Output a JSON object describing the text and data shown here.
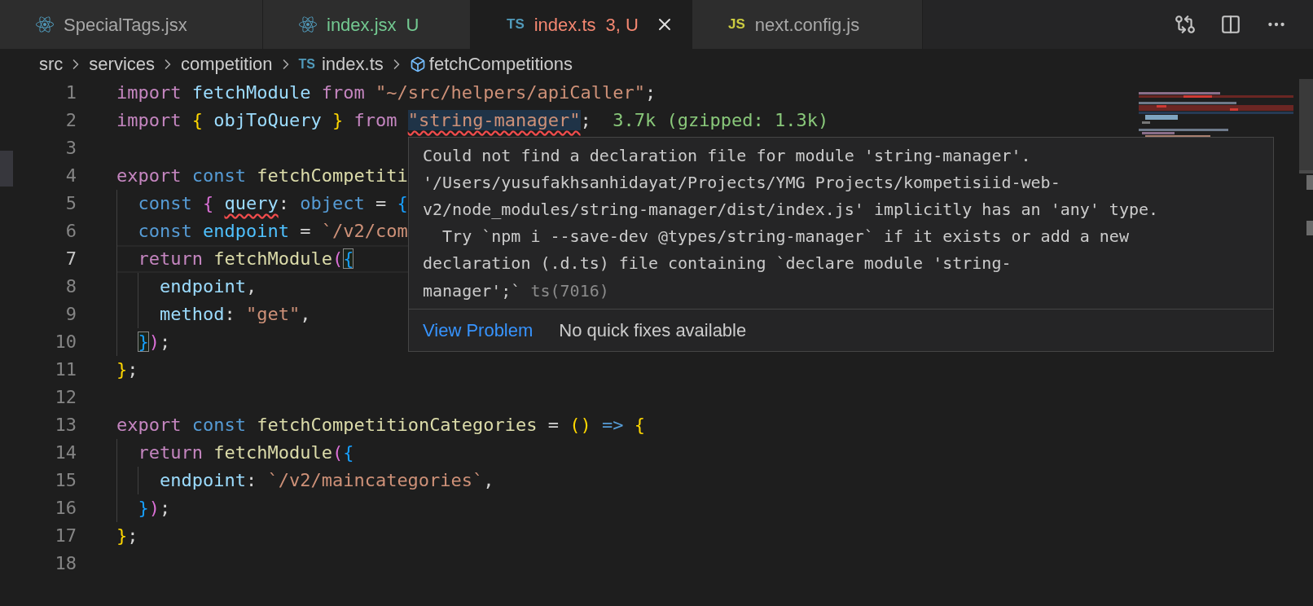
{
  "tabs": [
    {
      "label": "SpecialTags.jsx",
      "kind": "react",
      "color": "#a8a8a8",
      "selected": false
    },
    {
      "label": "index.jsx",
      "kind": "react",
      "color": "#73c991",
      "decoration": "U",
      "selected": false
    },
    {
      "label": "index.ts",
      "kind": "ts",
      "icon_text": "TS",
      "color": "#f48771",
      "decoration": "3, U",
      "selected": true
    },
    {
      "label": "next.config.js",
      "kind": "js",
      "icon_text": "JS",
      "color": "#a8a8a8",
      "selected": false
    }
  ],
  "breadcrumbs": [
    {
      "label": "src",
      "kind": "folder"
    },
    {
      "label": "services",
      "kind": "folder"
    },
    {
      "label": "competition",
      "kind": "folder"
    },
    {
      "label": "index.ts",
      "kind": "file",
      "icon_text": "TS"
    },
    {
      "label": "fetchCompetitions",
      "kind": "symbol"
    }
  ],
  "code_lines": [
    {
      "number": "1",
      "current": false,
      "tokens": [
        {
          "t": "import ",
          "kind": "kw"
        },
        {
          "t": "fetchModule ",
          "kind": "var"
        },
        {
          "t": "from ",
          "kind": "kw"
        },
        {
          "t": "\"~/src/helpers/apiCaller\"",
          "kind": "str"
        },
        {
          "t": ";",
          "kind": "p"
        }
      ]
    },
    {
      "number": "2",
      "current": false,
      "tokens": [
        {
          "t": "import ",
          "kind": "kw"
        },
        {
          "t": "{",
          "kind": "b1"
        },
        {
          "t": " objToQuery ",
          "kind": "var"
        },
        {
          "t": "}",
          "kind": "b1"
        },
        {
          "t": " from ",
          "kind": "kw"
        },
        {
          "t": "\"string-manager\"",
          "kind": "str",
          "error": true,
          "highlighted": true
        },
        {
          "t": ";",
          "kind": "p"
        },
        {
          "t": "  3.7k (gzipped: 1.3k)",
          "kind": "size"
        }
      ]
    },
    {
      "number": "3",
      "current": false
    },
    {
      "number": "4",
      "current": false,
      "tokens": [
        {
          "t": "export ",
          "kind": "kw"
        },
        {
          "t": "const ",
          "kind": "decl"
        },
        {
          "t": "fetchCompetiti",
          "kind": "fn"
        }
      ]
    },
    {
      "number": "5",
      "current": false,
      "tokens": [
        {
          "t": "  const ",
          "kind": "decl"
        },
        {
          "t": "{ ",
          "kind": "b2"
        },
        {
          "t": "query",
          "kind": "var",
          "error": true
        },
        {
          "t": ": ",
          "kind": "p"
        },
        {
          "t": "object ",
          "kind": "decl"
        },
        {
          "t": "= ",
          "kind": "p"
        },
        {
          "t": "{",
          "kind": "b3"
        }
      ]
    },
    {
      "number": "6",
      "current": false,
      "tokens": [
        {
          "t": "  const ",
          "kind": "decl"
        },
        {
          "t": "endpoint ",
          "kind": "const"
        },
        {
          "t": "= ",
          "kind": "p"
        },
        {
          "t": "`/v2/com",
          "kind": "str"
        }
      ]
    },
    {
      "number": "7",
      "current": true,
      "tokens": [
        {
          "t": "  return ",
          "kind": "kw"
        },
        {
          "t": "fetchModule",
          "kind": "fn"
        },
        {
          "t": "(",
          "kind": "b2"
        },
        {
          "t": "{",
          "kind": "b3",
          "matched": true
        }
      ]
    },
    {
      "number": "8",
      "current": false,
      "tokens": [
        {
          "t": "    endpoint",
          "kind": "var"
        },
        {
          "t": ",",
          "kind": "p"
        }
      ]
    },
    {
      "number": "9",
      "current": false,
      "tokens": [
        {
          "t": "    method",
          "kind": "var"
        },
        {
          "t": ": ",
          "kind": "p"
        },
        {
          "t": "\"get\"",
          "kind": "str"
        },
        {
          "t": ",",
          "kind": "p"
        }
      ]
    },
    {
      "number": "10",
      "current": false,
      "tokens": [
        {
          "t": "  }",
          "kind": "b3",
          "matched": true
        },
        {
          "t": ")",
          "kind": "b2"
        },
        {
          "t": ";",
          "kind": "p"
        }
      ]
    },
    {
      "number": "11",
      "current": false,
      "tokens": [
        {
          "t": "}",
          "kind": "b1"
        },
        {
          "t": ";",
          "kind": "p"
        }
      ]
    },
    {
      "number": "12",
      "current": false
    },
    {
      "number": "13",
      "current": false,
      "tokens": [
        {
          "t": "export ",
          "kind": "kw"
        },
        {
          "t": "const ",
          "kind": "decl"
        },
        {
          "t": "fetchCompetitionCategories ",
          "kind": "fn"
        },
        {
          "t": "= ",
          "kind": "p"
        },
        {
          "t": "()",
          "kind": "b1"
        },
        {
          "t": " => ",
          "kind": "decl"
        },
        {
          "t": "{",
          "kind": "b1"
        }
      ]
    },
    {
      "number": "14",
      "current": false,
      "tokens": [
        {
          "t": "  return ",
          "kind": "kw"
        },
        {
          "t": "fetchModule",
          "kind": "fn"
        },
        {
          "t": "(",
          "kind": "b2"
        },
        {
          "t": "{",
          "kind": "b3"
        }
      ]
    },
    {
      "number": "15",
      "current": false,
      "tokens": [
        {
          "t": "    endpoint",
          "kind": "var"
        },
        {
          "t": ": ",
          "kind": "p"
        },
        {
          "t": "`/v2/maincategories`",
          "kind": "str"
        },
        {
          "t": ",",
          "kind": "p"
        }
      ]
    },
    {
      "number": "16",
      "current": false,
      "tokens": [
        {
          "t": "  }",
          "kind": "b3"
        },
        {
          "t": ")",
          "kind": "b2"
        },
        {
          "t": ";",
          "kind": "p"
        }
      ]
    },
    {
      "number": "17",
      "current": false,
      "tokens": [
        {
          "t": "}",
          "kind": "b1"
        },
        {
          "t": ";",
          "kind": "p"
        }
      ]
    },
    {
      "number": "18",
      "current": false
    }
  ],
  "hover": {
    "message_lines": [
      "Could not find a declaration file for module 'string-manager'.",
      "'/Users/yusufakhsanhidayat/Projects/YMG Projects/kompetisiid-web-",
      "v2/node_modules/string-manager/dist/index.js' implicitly has an 'any' type.",
      "  Try `npm i --save-dev @types/string-manager` if it exists or add a new",
      "declaration (.d.ts) file containing `declare module 'string-",
      "manager';`"
    ],
    "source": "ts(7016)",
    "actions": [
      {
        "label": "View Problem",
        "kind": "link"
      },
      {
        "label": "No quick fixes available",
        "kind": "text"
      }
    ]
  }
}
